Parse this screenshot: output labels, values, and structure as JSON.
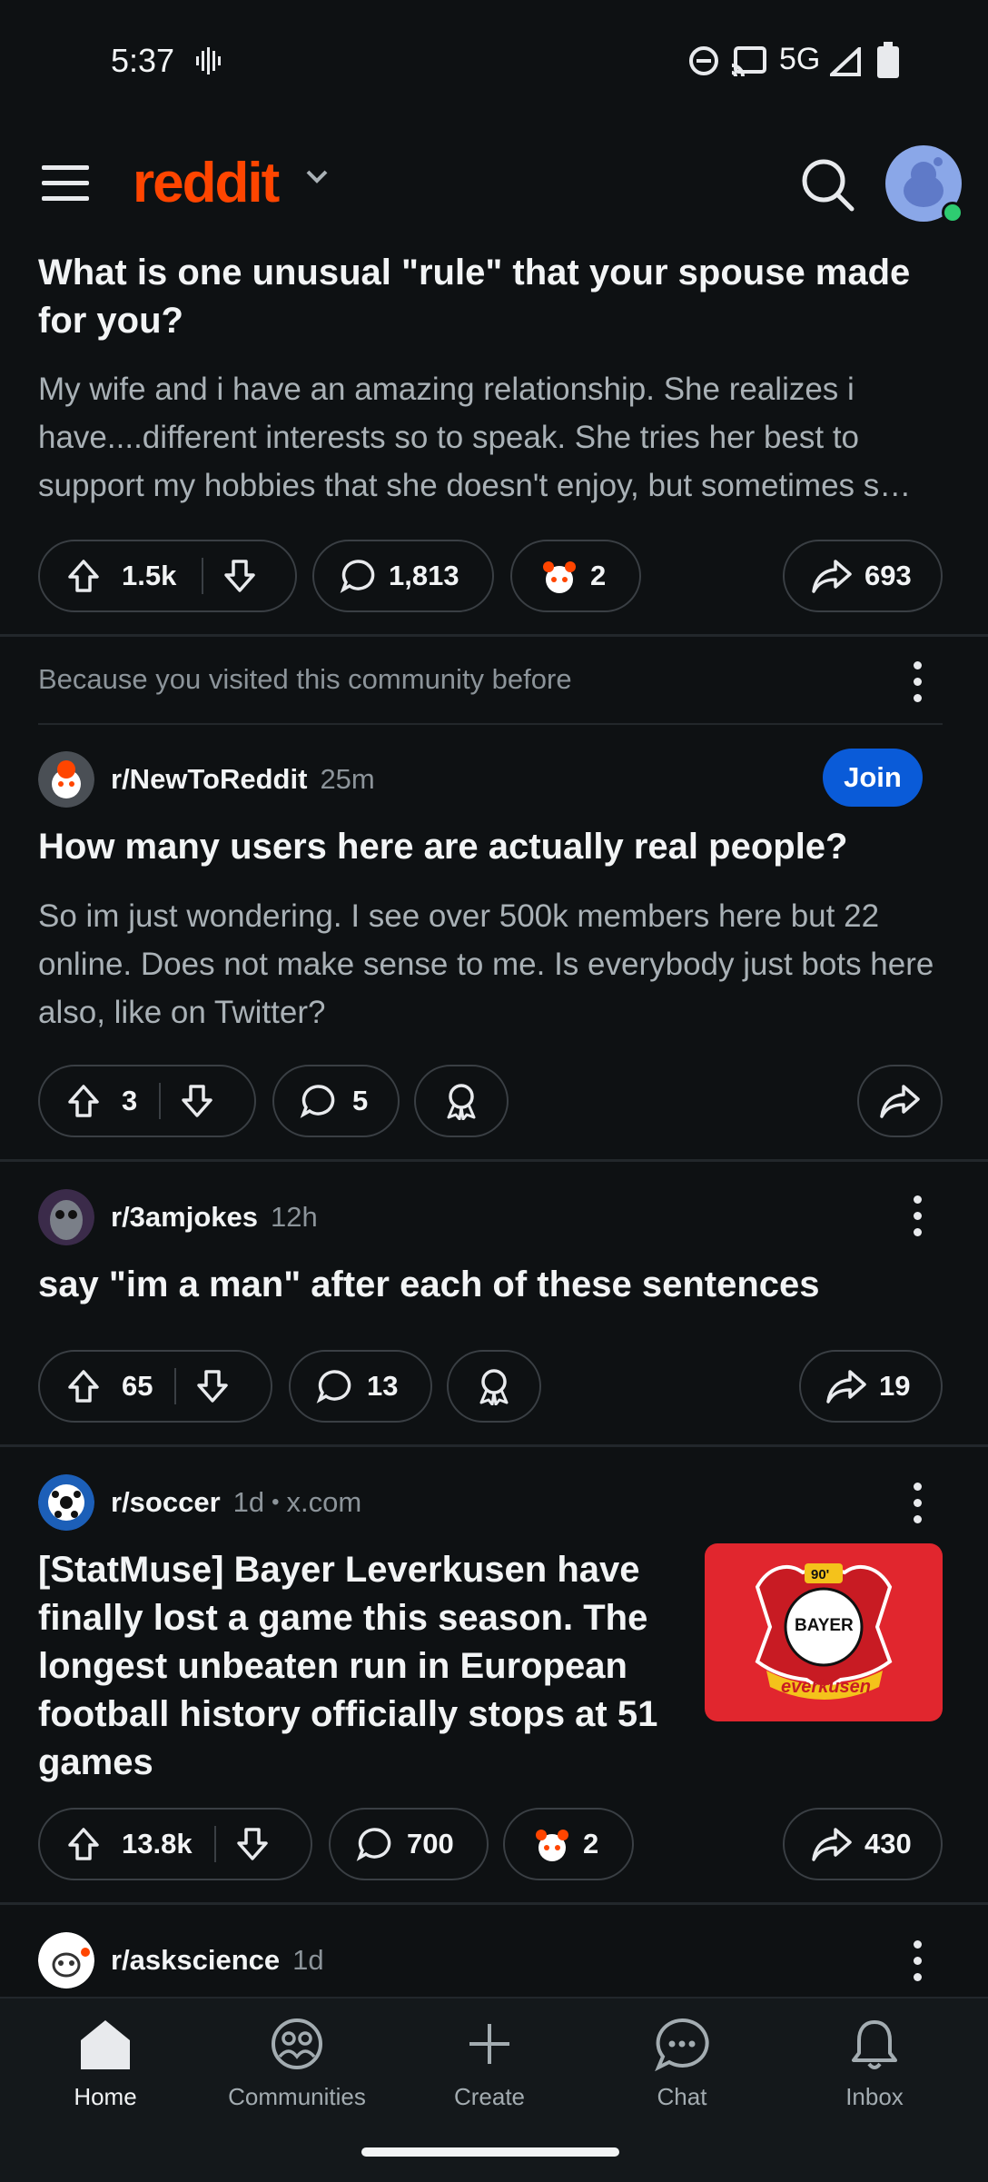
{
  "status_bar": {
    "time": "5:37",
    "network": "5G"
  },
  "header": {
    "logo": "reddit"
  },
  "posts": [
    {
      "title": "What is one unusual \"rule\" that your spouse made for you?",
      "body": "My wife and i have an amazing relationship. She realizes i have....different interests so to speak. She tries her best to support my hobbies that she doesn't enjoy, but sometimes s…",
      "upvotes": "1.5k",
      "comments": "1,813",
      "awards": "2",
      "shares": "693"
    },
    {
      "recommendation": "Because you visited this community before",
      "subreddit": "r/NewToReddit",
      "time": "25m",
      "join_label": "Join",
      "title": "How many users here are actually real people?",
      "body": "So im just wondering. I see over 500k members here but 22 online. Does not make sense to me. Is everybody just bots here also, like on Twitter?",
      "upvotes": "3",
      "comments": "5"
    },
    {
      "subreddit": "r/3amjokes",
      "time": "12h",
      "title": "say \"im a man\" after each of these sentences",
      "upvotes": "65",
      "comments": "13",
      "shares": "19"
    },
    {
      "subreddit": "r/soccer",
      "time": "1d",
      "domain": "x.com",
      "separator": "•",
      "title": "[StatMuse] Bayer Leverkusen have finally lost a game this season. The longest unbeaten run in European football history officially stops at 51 games",
      "upvotes": "13.8k",
      "comments": "700",
      "awards": "2",
      "shares": "430",
      "thumbnail_text": {
        "minute": "90'",
        "logo_top": "BAYER",
        "logo_side": "BAYER",
        "banner": "everkusen"
      }
    },
    {
      "subreddit": "r/askscience",
      "time": "1d"
    }
  ],
  "bottom_nav": [
    {
      "label": "Home",
      "icon": "home-icon",
      "active": true
    },
    {
      "label": "Communities",
      "icon": "communities-icon"
    },
    {
      "label": "Create",
      "icon": "plus-icon"
    },
    {
      "label": "Chat",
      "icon": "chat-icon"
    },
    {
      "label": "Inbox",
      "icon": "bell-icon"
    }
  ],
  "colors": {
    "brand": "#ff4500",
    "join": "#0a5bd8",
    "background": "#0e1113"
  }
}
